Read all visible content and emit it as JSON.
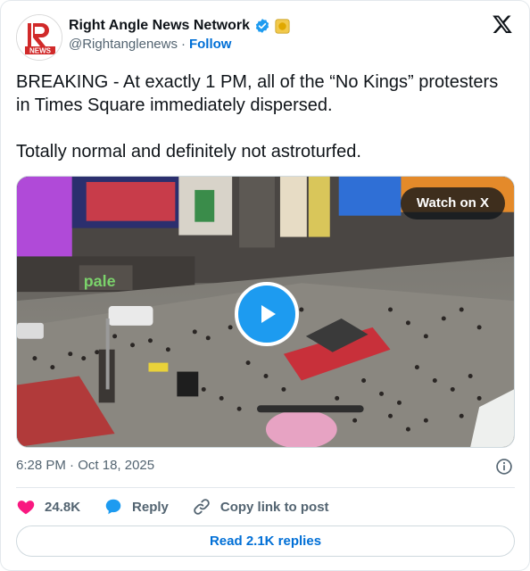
{
  "author": {
    "name": "Right Angle News Network",
    "handle": "@Rightanglenews",
    "separator": "·",
    "follow_label": "Follow",
    "avatar_text": "NEWS"
  },
  "tweet": {
    "line1": "BREAKING - At exactly 1 PM, all of the “No Kings” protesters in Times Square immediately dispersed.",
    "line2": "Totally normal and definitely not astroturfed."
  },
  "media": {
    "watch_label": "Watch on X",
    "billboard_text": "pale"
  },
  "meta": {
    "time": "6:28 PM",
    "separator": "·",
    "date": "Oct 18, 2025"
  },
  "actions": {
    "likes": "24.8K",
    "reply_label": "Reply",
    "copy_label": "Copy link to post"
  },
  "replies_button": "Read 2.1K replies",
  "colors": {
    "accent": "#1d9bf0",
    "link": "#006fd6",
    "like": "#f91880",
    "muted": "#536471"
  }
}
